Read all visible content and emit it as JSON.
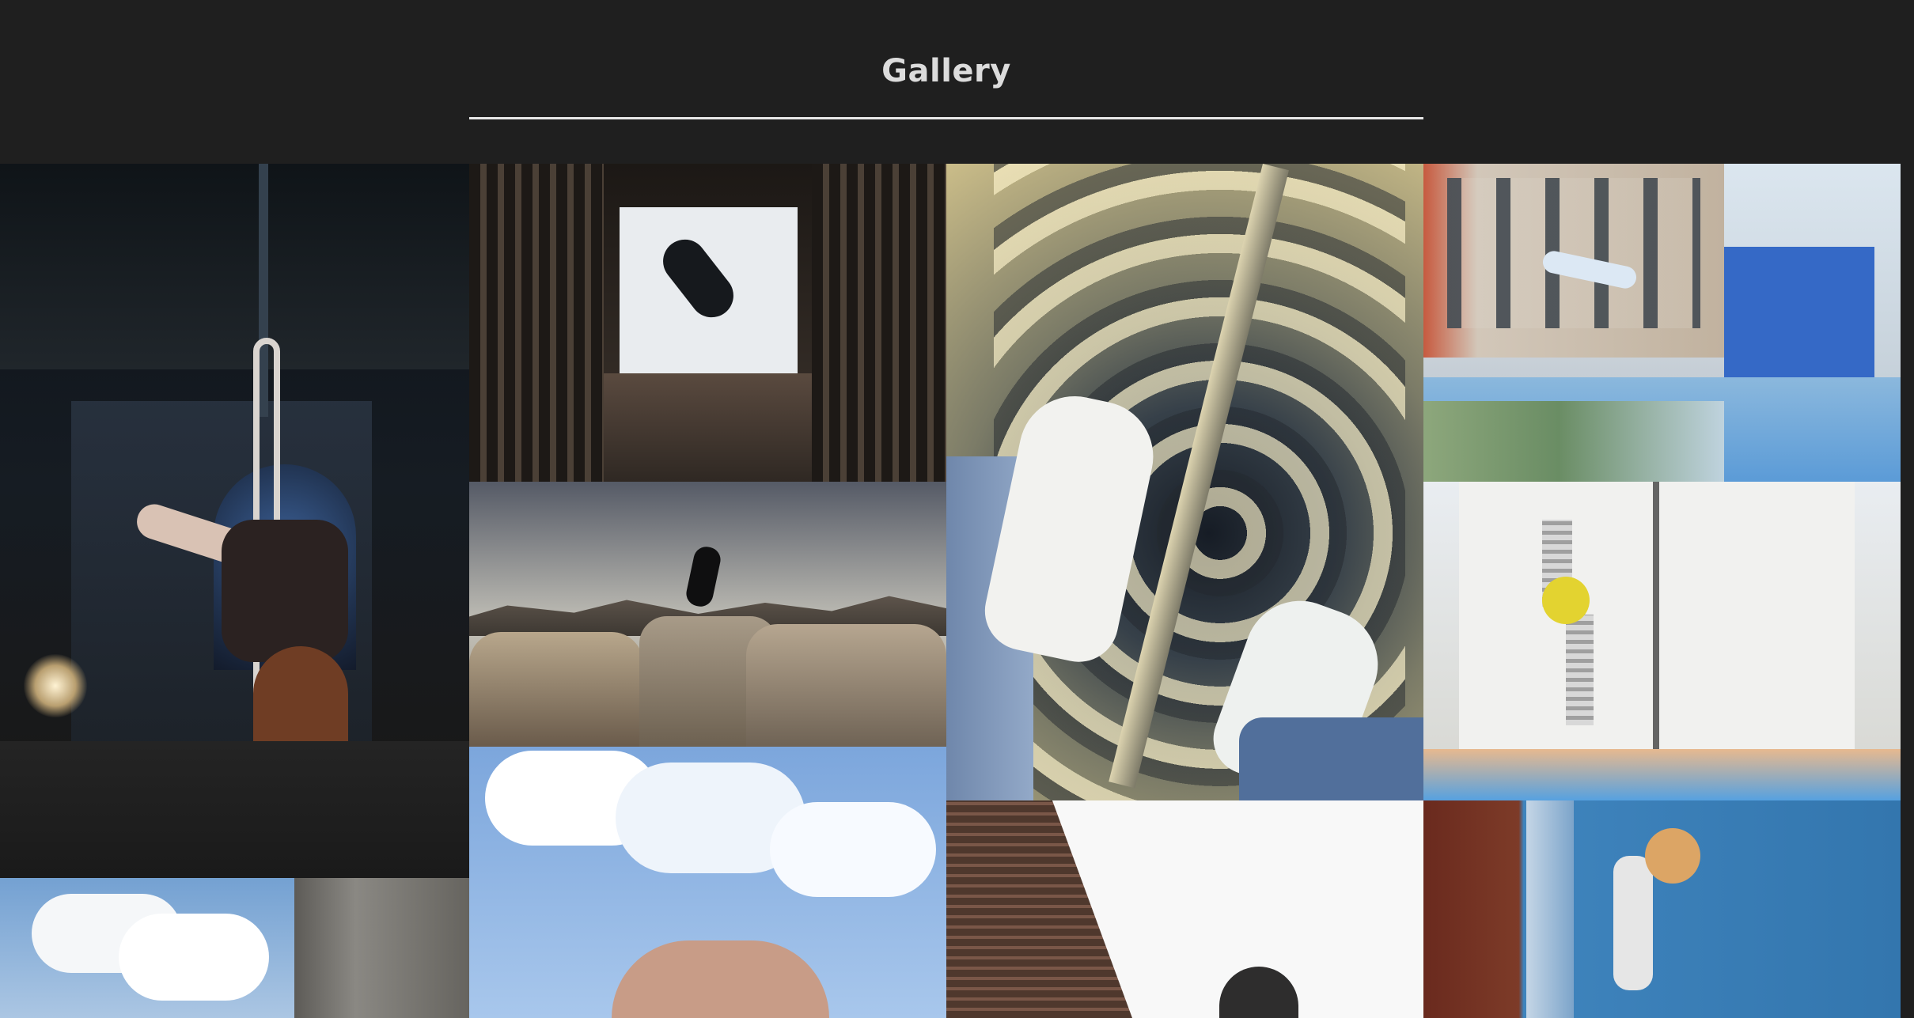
{
  "page": {
    "title": "Gallery"
  },
  "colors": {
    "background": "#1f1f1f",
    "title": "#dcdcdc",
    "divider": "#e6e6e6"
  },
  "gallery": {
    "tiles": [
      {
        "name": "aerial-hoop-performer-photo"
      },
      {
        "name": "backflip-in-wooden-tunnel-photo"
      },
      {
        "name": "jump-between-rooftops-photo"
      },
      {
        "name": "sky-jump-low-angle-photo"
      },
      {
        "name": "hanging-over-stairwell-photo"
      },
      {
        "name": "brick-wall-climber-photo"
      },
      {
        "name": "street-flip-over-mats-photo"
      },
      {
        "name": "flip-by-white-building-photo"
      },
      {
        "name": "indoor-wall-climber-photo"
      },
      {
        "name": "clouds-and-concrete-photo"
      }
    ]
  }
}
